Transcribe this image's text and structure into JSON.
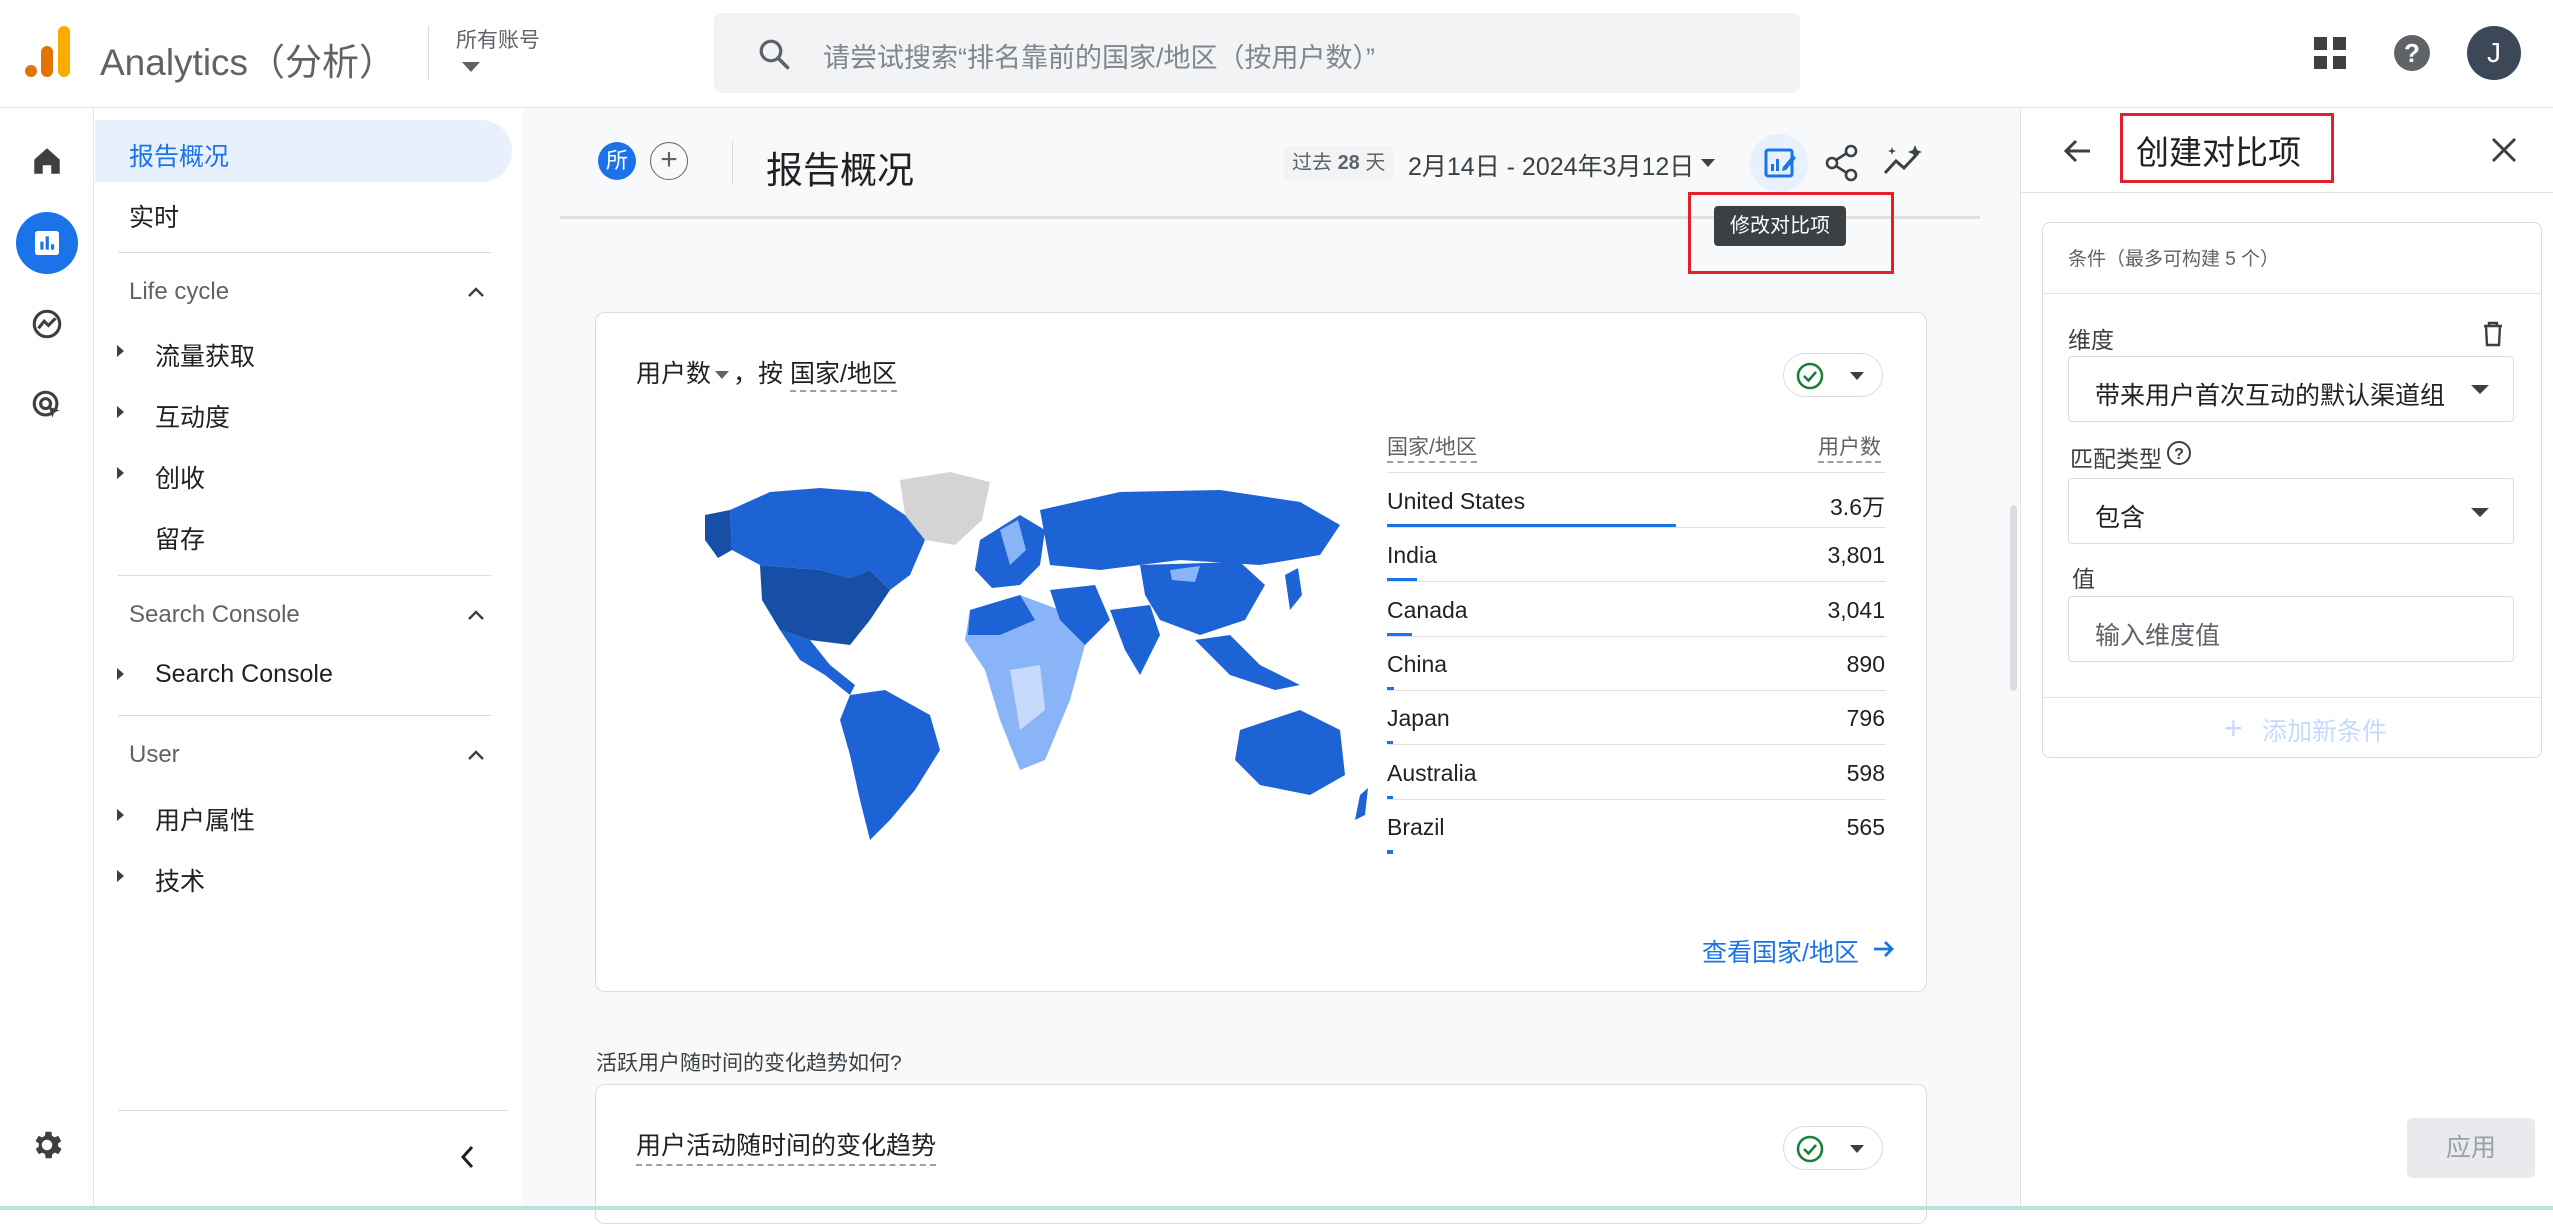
{
  "topbar": {
    "app_title": "Analytics（分析）",
    "account_label": "所有账号",
    "search_placeholder": "请尝试搜索“排名靠前的国家/地区（按用户数）”",
    "avatar_letter": "J"
  },
  "sidebar": {
    "items": [
      {
        "label": "报告概况",
        "selected": true
      },
      {
        "label": "实时"
      }
    ],
    "sections": [
      {
        "title": "Life cycle",
        "items": [
          "流量获取",
          "互动度",
          "创收",
          "留存"
        ]
      },
      {
        "title": "Search Console",
        "items": [
          "Search Console"
        ]
      },
      {
        "title": "User",
        "items": [
          "用户属性",
          "技术"
        ]
      }
    ]
  },
  "report": {
    "badge": "所",
    "title": "报告概况",
    "range_prefix": "过去",
    "range_days": "28",
    "range_unit": "天",
    "range_dates": "2月14日 - 2024年3月12日",
    "tooltip": "修改对比项"
  },
  "card_users_by_country": {
    "metric": "用户数",
    "by": "，按",
    "dimension": "国家/地区",
    "col_country": "国家/地区",
    "col_users": "用户数",
    "rows": [
      {
        "country": "United States",
        "value": "3.6万",
        "share": 0.58
      },
      {
        "country": "India",
        "value": "3,801",
        "share": 0.06
      },
      {
        "country": "Canada",
        "value": "3,041",
        "share": 0.05
      },
      {
        "country": "China",
        "value": "890",
        "share": 0.015
      },
      {
        "country": "Japan",
        "value": "796",
        "share": 0.013
      },
      {
        "country": "Australia",
        "value": "598",
        "share": 0.01
      },
      {
        "country": "Brazil",
        "value": "565",
        "share": 0.009
      }
    ],
    "view_link": "查看国家/地区"
  },
  "question_text": "活跃用户随时间的变化趋势如何?",
  "card_trend": {
    "title": "用户活动随时间的变化趋势"
  },
  "panel": {
    "title": "创建对比项",
    "conditions_label": "条件（最多可构建 5 个）",
    "dimension_label": "维度",
    "dimension_value": "带来用户首次互动的默认渠道组",
    "match_label": "匹配类型",
    "match_value": "包含",
    "value_label": "值",
    "value_placeholder": "输入维度值",
    "add_condition": "添加新条件",
    "apply": "应用"
  },
  "colors": {
    "accent": "#1a73e8",
    "highlight": "#e0202b",
    "map_dark": "#174ea6",
    "map_mid": "#1e63d6",
    "map_light": "#8ab4f8"
  }
}
